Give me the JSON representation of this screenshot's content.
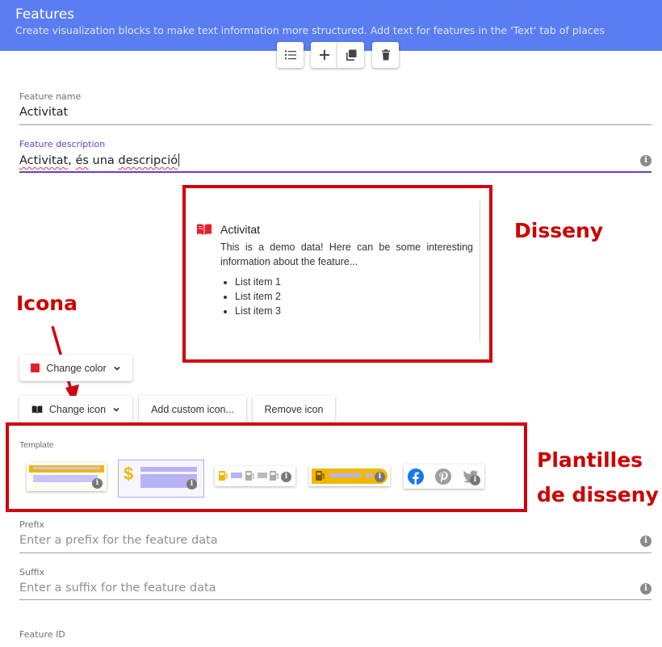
{
  "header": {
    "title": "Features",
    "subtitle": "Create visualization blocks to make text information more structured. Add text for features in the 'Text' tab of places"
  },
  "toolbar": {
    "items": [
      {
        "icon": "list-icon"
      },
      {
        "icon": "add-icon"
      },
      {
        "icon": "copy-icon"
      },
      {
        "icon": "delete-icon"
      }
    ]
  },
  "feature_name": {
    "label": "Feature name",
    "value": "Activitat"
  },
  "feature_description": {
    "label": "Feature description",
    "value_prefix": "Activitat",
    "value_sep": ", ",
    "value_word1": "és",
    "value_mid": " una ",
    "value_word2": "descripció"
  },
  "preview": {
    "icon": "book-icon",
    "title": "Activitat",
    "text": "This is a demo data! Here can be some interesting information about the feature...",
    "list": [
      "List item 1",
      "List item 2",
      "List item 3"
    ],
    "accent_color": "#e5202e"
  },
  "buttons": {
    "change_color": "Change color",
    "change_icon": "Change icon",
    "add_custom_icon": "Add custom icon...",
    "remove_icon": "Remove icon"
  },
  "template": {
    "label": "Template",
    "options": [
      {
        "name": "template-text-bars"
      },
      {
        "name": "template-dollar"
      },
      {
        "name": "template-fuel-row"
      },
      {
        "name": "template-fuel-pill"
      },
      {
        "name": "template-social"
      }
    ],
    "selected_index": 1
  },
  "prefix": {
    "label": "Prefix",
    "placeholder": "Enter a prefix for the feature data"
  },
  "suffix": {
    "label": "Suffix",
    "placeholder": "Enter a suffix for the feature data"
  },
  "feature_id": {
    "label": "Feature ID"
  },
  "annotations": {
    "design": "Disseny",
    "icon": "Icona",
    "templates_line1": "Plantilles",
    "templates_line2": "de disseny"
  },
  "colors": {
    "header": "#5a7df2",
    "annotation": "#d0000f",
    "focus": "#6a3fc4"
  }
}
